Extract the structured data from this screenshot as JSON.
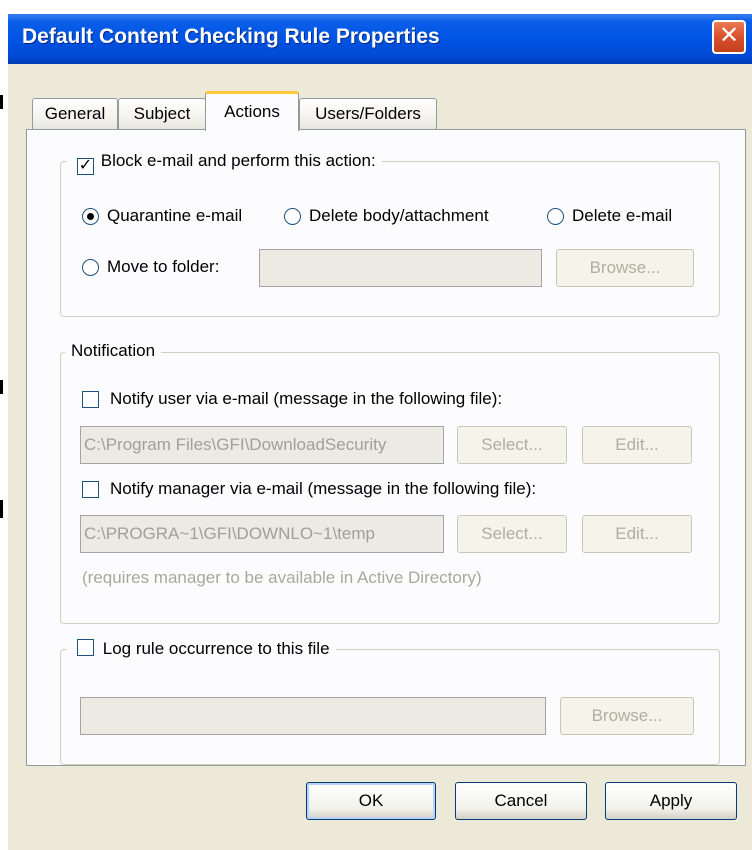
{
  "dialog": {
    "title": "Default Content Checking Rule Properties",
    "close_symbol": "✕"
  },
  "tabs": [
    {
      "label": "General",
      "active": false
    },
    {
      "label": "Subject",
      "active": false
    },
    {
      "label": "Actions",
      "active": true
    },
    {
      "label": "Users/Folders",
      "active": false
    }
  ],
  "block_group": {
    "checkbox_label": "Block e-mail and perform this action:",
    "checked": true,
    "radios": [
      {
        "label": "Quarantine e-mail",
        "selected": true
      },
      {
        "label": "Delete body/attachment",
        "selected": false
      },
      {
        "label": "Delete e-mail",
        "selected": false
      },
      {
        "label": "Move to folder:",
        "selected": false
      }
    ],
    "folder_value": "",
    "browse_label": "Browse..."
  },
  "notification_group": {
    "legend": "Notification",
    "notify_user_label": "Notify user via e-mail (message in the following file):",
    "notify_user_checked": false,
    "notify_user_path": "C:\\Program Files\\GFI\\DownloadSecurity",
    "notify_manager_label": "Notify manager via e-mail (message in the following file):",
    "notify_manager_checked": false,
    "notify_manager_path": "C:\\PROGRA~1\\GFI\\DOWNLO~1\\temp",
    "select_label": "Select...",
    "edit_label": "Edit...",
    "manager_note": "(requires manager to be available in Active Directory)"
  },
  "log_group": {
    "checkbox_label": "Log rule occurrence to this file",
    "checked": false,
    "file_value": "",
    "browse_label": "Browse..."
  },
  "footer": {
    "ok_label": "OK",
    "cancel_label": "Cancel",
    "apply_label": "Apply"
  },
  "colors": {
    "titlebar": "#0054e3",
    "dialog_face": "#ECE9D8",
    "annotation_line": "#e0431c",
    "active_tab_highlight": "#ffc83c"
  }
}
